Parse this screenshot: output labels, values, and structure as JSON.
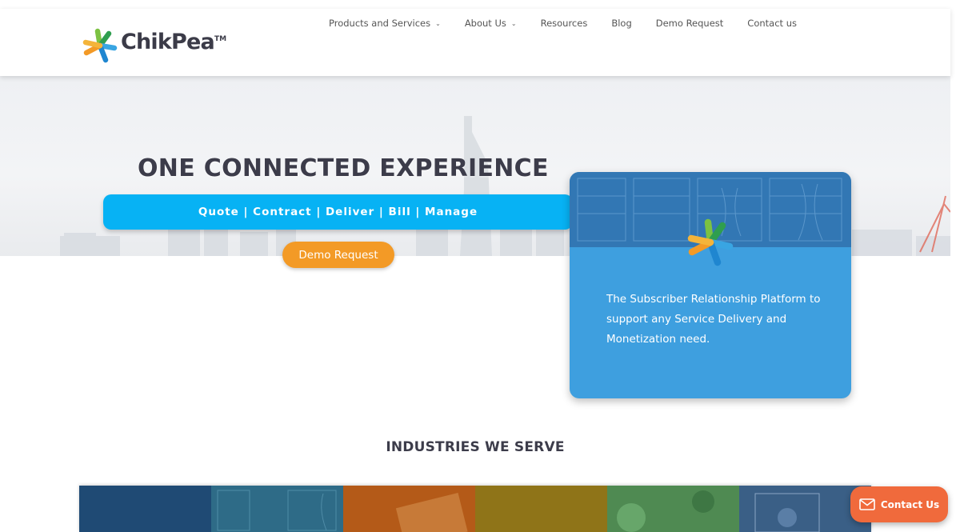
{
  "brand": {
    "name": "ChikPea",
    "tm": "TM"
  },
  "nav": {
    "items": [
      {
        "label": "Products and Services",
        "has_dropdown": true
      },
      {
        "label": "About Us",
        "has_dropdown": true
      },
      {
        "label": "Resources",
        "has_dropdown": false
      },
      {
        "label": "Blog",
        "has_dropdown": false
      },
      {
        "label": "Demo Request",
        "has_dropdown": false
      },
      {
        "label": "Contact us",
        "has_dropdown": false
      }
    ],
    "dropdown_icon": "chevron-down-icon"
  },
  "hero": {
    "title": "ONE CONNECTED EXPERIENCE",
    "tagline": "Quote | Contract | Deliver | Bill | Manage",
    "cta_label": "Demo Request",
    "band_color": "#07b2f4",
    "cta_color": "#f39a26"
  },
  "card": {
    "text": "The Subscriber Relationship Platform to support any Service Delivery and Monetization need.",
    "color": "#3e9fdf"
  },
  "industries": {
    "title": "INDUSTRIES WE SERVE",
    "tile_colors": [
      "#1f4a74",
      "#2e6b87",
      "#b45a18",
      "#8f7418",
      "#4f8a52",
      "#3a5f86"
    ]
  },
  "contact_float": {
    "label": "Contact Us",
    "icon": "mail-icon",
    "color": "#f06a3c"
  }
}
